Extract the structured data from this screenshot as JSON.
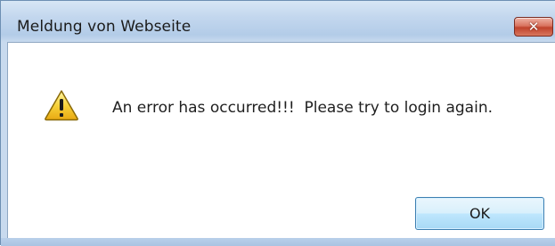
{
  "dialog": {
    "title": "Meldung von Webseite",
    "message": "An error has occurred!!!  Please try to login again.",
    "ok_label": "OK",
    "close_glyph": "✕",
    "icon": "warning-icon",
    "colors": {
      "titlebar": "#c3d7ee",
      "close_button": "#c0422b",
      "ok_button": "#bee6fd",
      "warning_yellow": "#f4c81d"
    }
  }
}
